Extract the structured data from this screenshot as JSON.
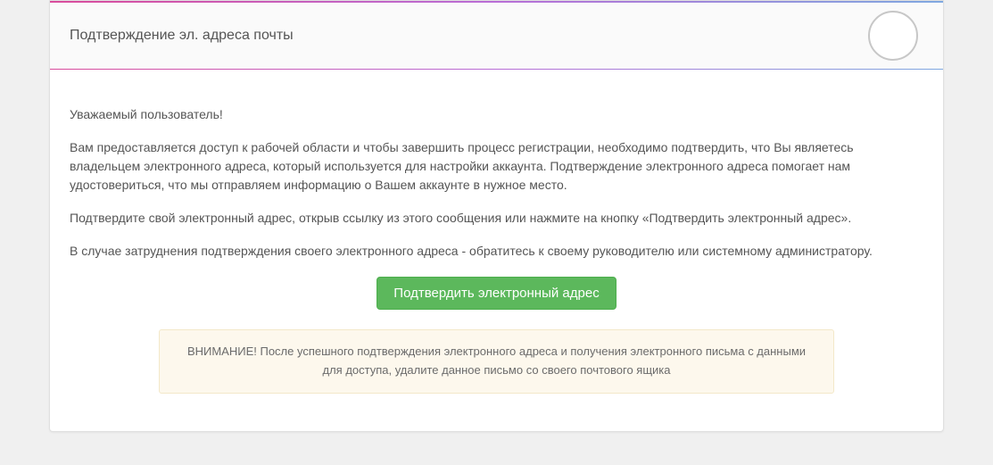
{
  "header": {
    "title": "Подтверждение эл. адреса почты"
  },
  "content": {
    "greeting": "Уважаемый пользователь!",
    "p_access": "Вам предоставляется доступ к рабочей области и чтобы завершить процесс регистрации, необходимо подтвердить, что Вы являетесь владельцем электронного адреса, который используется для настройки аккаунта. Подтверждение электронного адреса помогает нам удостовериться, что мы отправляем информацию о Вашем аккаунте в нужное место.",
    "p_confirm": "Подтвердите свой электронный адрес, открыв ссылку из этого сообщения или нажмите на кнопку «Подтвердить электронный адрес».",
    "p_trouble": "В случае затруднения подтверждения своего электронного адреса - обратитесь к своему руководителю или системному администратору.",
    "btn_confirm": "Подтвердить электронный адрес",
    "warning": "ВНИМАНИЕ! После успешного подтверждения электронного адреса и получения электронного письма с данными для доступа, удалите данное письмо со своего почтового ящика"
  }
}
